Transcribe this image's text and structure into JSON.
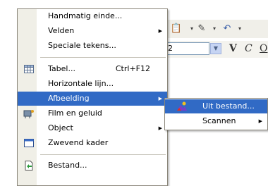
{
  "toolbar": {
    "size_value": "2",
    "bold_label": "V",
    "italic_label": "C",
    "underline_label": "O"
  },
  "menu": {
    "items": [
      {
        "label": "Handmatig einde...",
        "arrow": false
      },
      {
        "label": "Velden",
        "arrow": true
      },
      {
        "label": "Speciale tekens...",
        "arrow": false
      },
      {
        "label": "Tabel...",
        "shortcut": "Ctrl+F12",
        "icon": "table-icon"
      },
      {
        "label": "Horizontale lijn..."
      },
      {
        "label": "Afbeelding",
        "arrow": true,
        "highlighted": true
      },
      {
        "label": "Film en geluid",
        "icon": "film-sound-icon"
      },
      {
        "label": "Object",
        "arrow": true
      },
      {
        "label": "Zwevend kader",
        "icon": "frame-icon"
      },
      {
        "label": "Bestand...",
        "icon": "file-insert-icon"
      }
    ]
  },
  "submenu": {
    "items": [
      {
        "label": "Uit bestand...",
        "highlighted": true,
        "icon": "image-file-icon"
      },
      {
        "label": "Scannen",
        "arrow": true
      }
    ]
  },
  "colors": {
    "highlight": "#316ac5",
    "gutter": "#f0efe7"
  }
}
